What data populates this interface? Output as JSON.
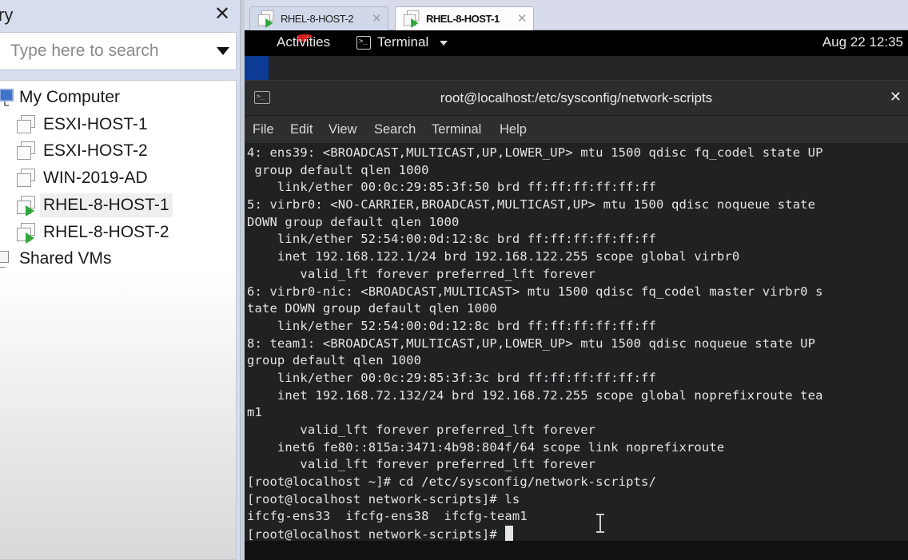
{
  "library": {
    "title": "ry",
    "close_glyph": "✕",
    "search": {
      "placeholder": "Type here to search",
      "value": ""
    },
    "tree": [
      {
        "label": "My Computer",
        "icon": "computer-icon",
        "level": 0
      },
      {
        "label": "ESXI-HOST-1",
        "icon": "vm-icon",
        "level": 1,
        "running": false
      },
      {
        "label": "ESXI-HOST-2",
        "icon": "vm-icon",
        "level": 1,
        "running": false
      },
      {
        "label": "WIN-2019-AD",
        "icon": "vm-icon",
        "level": 1,
        "running": false
      },
      {
        "label": "RHEL-8-HOST-1",
        "icon": "vm-running-icon",
        "level": 1,
        "running": true,
        "selected": true
      },
      {
        "label": "RHEL-8-HOST-2",
        "icon": "vm-running-icon",
        "level": 1,
        "running": true
      },
      {
        "label": "Shared VMs",
        "icon": "shared-vms-icon",
        "level": 0
      }
    ]
  },
  "tabs": [
    {
      "label": "RHEL-8-HOST-2",
      "active": false,
      "close_glyph": "✕"
    },
    {
      "label": "RHEL-8-HOST-1",
      "active": true,
      "close_glyph": "✕"
    }
  ],
  "guest": {
    "topbar": {
      "activities": "Activities",
      "app_menu": "Terminal",
      "clock": "Aug 22  12:35"
    },
    "terminal": {
      "title": "root@localhost:/etc/sysconfig/network-scripts",
      "close_glyph": "✕",
      "menu": [
        "File",
        "Edit",
        "View",
        "Search",
        "Terminal",
        "Help"
      ],
      "lines": [
        "4: ens39: <BROADCAST,MULTICAST,UP,LOWER_UP> mtu 1500 qdisc fq_codel state UP",
        " group default qlen 1000",
        "    link/ether 00:0c:29:85:3f:50 brd ff:ff:ff:ff:ff:ff",
        "5: virbr0: <NO-CARRIER,BROADCAST,MULTICAST,UP> mtu 1500 qdisc noqueue state",
        "DOWN group default qlen 1000",
        "    link/ether 52:54:00:0d:12:8c brd ff:ff:ff:ff:ff:ff",
        "    inet 192.168.122.1/24 brd 192.168.122.255 scope global virbr0",
        "       valid_lft forever preferred_lft forever",
        "6: virbr0-nic: <BROADCAST,MULTICAST> mtu 1500 qdisc fq_codel master virbr0 s",
        "tate DOWN group default qlen 1000",
        "    link/ether 52:54:00:0d:12:8c brd ff:ff:ff:ff:ff:ff",
        "8: team1: <BROADCAST,MULTICAST,UP,LOWER_UP> mtu 1500 qdisc noqueue state UP",
        "group default qlen 1000",
        "    link/ether 00:0c:29:85:3f:3c brd ff:ff:ff:ff:ff:ff",
        "    inet 192.168.72.132/24 brd 192.168.72.255 scope global noprefixroute tea",
        "m1",
        "       valid_lft forever preferred_lft forever",
        "    inet6 fe80::815a:3471:4b98:804f/64 scope link noprefixroute",
        "       valid_lft forever preferred_lft forever",
        "[root@localhost ~]# cd /etc/sysconfig/network-scripts/",
        "[root@localhost network-scripts]# ls",
        "ifcfg-ens33  ifcfg-ens38  ifcfg-team1"
      ],
      "prompt": "[root@localhost network-scripts]# "
    }
  },
  "colors": {
    "library_bg": "#d6ddee",
    "terminal_bg": "#1f2123",
    "terminal_fg": "#e3e3e3",
    "vm_running": "#2fa83a",
    "redhat": "#d62020",
    "desktop_blue": "#0b3b94"
  }
}
